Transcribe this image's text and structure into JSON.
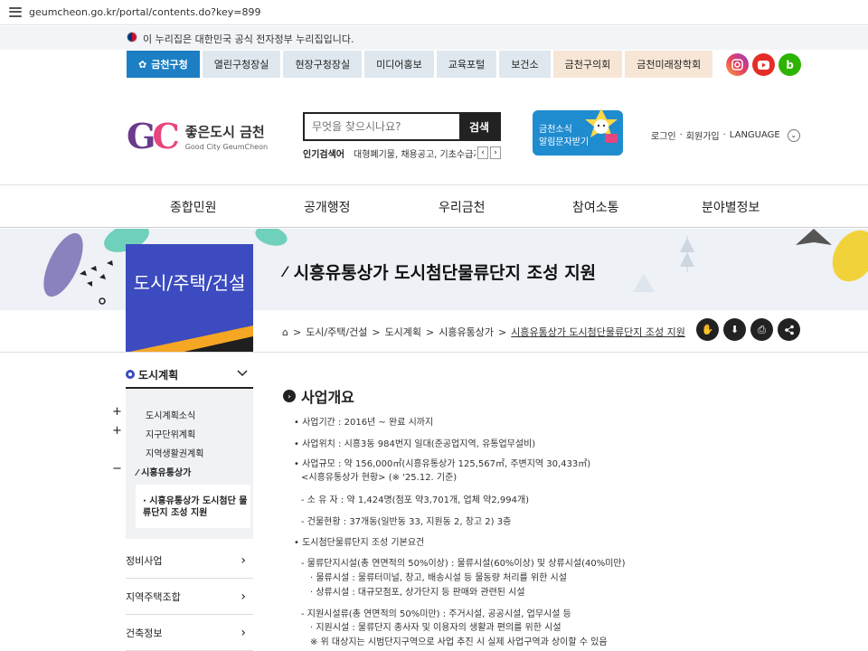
{
  "browser": {
    "url": "geumcheon.go.kr/portal/contents.do?key=899"
  },
  "gov_banner": {
    "text": "이 누리집은 대한민국 공식 전자정부 누리집입니다."
  },
  "top_tabs": [
    {
      "label": "금천구청",
      "active": true
    },
    {
      "label": "열린구청장실"
    },
    {
      "label": "현장구청장실"
    },
    {
      "label": "미디어홍보"
    },
    {
      "label": "교육포털"
    },
    {
      "label": "보건소"
    },
    {
      "label": "금천구의회"
    },
    {
      "label": "금천미래장학회"
    }
  ],
  "social": {
    "blog_glyph": "b"
  },
  "logo": {
    "mark_g": "G",
    "mark_c": "C",
    "ko": "좋은도시 금천",
    "en": "Good City GeumCheon"
  },
  "search": {
    "placeholder": "무엇을 찾으시나요?",
    "button": "검색"
  },
  "popular": {
    "label": "인기검색어",
    "keywords": "대형폐기물, 채용공고, 기초수급자, 고"
  },
  "sms_banner": {
    "line1": "금천소식",
    "line2": "알림문자받기",
    "badge": "SMS"
  },
  "util": {
    "login": "로그인",
    "sep": "·",
    "join": "회원가입",
    "language": "LANGUAGE"
  },
  "gnb": [
    "종합민원",
    "공개행정",
    "우리금천",
    "참여소통",
    "분야별정보"
  ],
  "section_title": "도시/주택/건설",
  "page_title": "시흥유통상가 도시첨단물류단지 조성 지원",
  "breadcrumb": [
    "도시/주택/건설",
    "도시계획",
    "시흥유통상가",
    "시흥유통상가 도시첨단물류단지 조성 지원"
  ],
  "lnb": {
    "head": "도시계획",
    "items": [
      {
        "label": "도시계획소식",
        "sign": "+"
      },
      {
        "label": "지구단위계획",
        "sign": "+"
      },
      {
        "label": "지역생활권계획",
        "sign": ""
      },
      {
        "label": "시흥유통상가",
        "sign": "−",
        "active": true
      }
    ],
    "sub_item": "시흥유통상가 도시첨단 물류단지 조성 지원",
    "rows": [
      "정비사업",
      "지역주택조합",
      "건축정보"
    ]
  },
  "content": {
    "heading": "사업개요",
    "lines": [
      "• 사업기간 : 2016년 ~ 완료 시까지",
      "• 사업위치 : 시흥3동 984번지 일대(준공업지역, 유통업무설비)",
      "• 사업규모 : 약 156,000㎡(시흥유통상가 125,567㎡, 주변지역 30,433㎡)",
      "<시흥유통상가 현황> (※ '25.12. 기준)",
      "- 소 유 자 : 약 1,424명(점포 약3,701개, 업체 약2,994개)",
      "- 건물현황 : 37개동(일반동 33, 지원동 2, 창고 2) 3층",
      "• 도시첨단물류단지 조성 기본요건",
      "- 물류단지시설(총 연면적의 50%이상) : 물류시설(60%이상) 및 상류시설(40%미만)",
      "· 물류시설 : 물류터미널, 창고, 배송시설 등 물동량 처리를 위한 시설",
      "· 상류시설 : 대규모점포, 상가단지 등 판매와 관련된 시설",
      "- 지원시설류(총 연면적의 50%미만) : 주거시설, 공공시설, 업무시설 등",
      "· 지원시설 : 물류단지 종사자 및 이용자의 생활과 편의를 위한 시설",
      "※ 위 대상지는 시범단지구역으로 사업 추진 시 실제 사업구역과 상이할 수 있음"
    ]
  }
}
